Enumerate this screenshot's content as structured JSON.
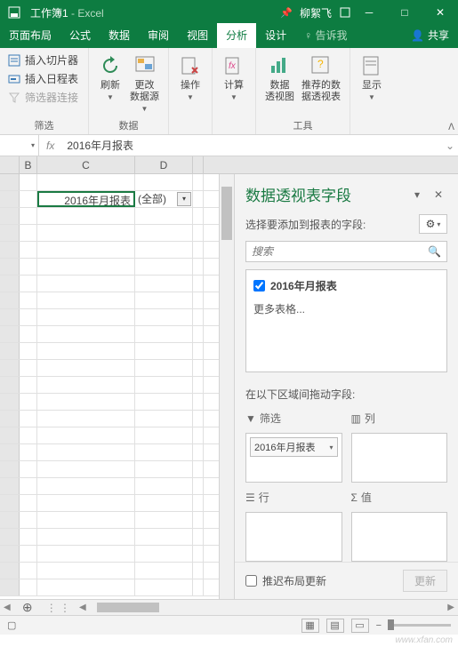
{
  "title": {
    "file": "工作簿1",
    "app": "Excel",
    "user": "柳絮飞"
  },
  "ribbonTabs": [
    "页面布局",
    "公式",
    "数据",
    "审阅",
    "视图",
    "分析",
    "设计"
  ],
  "activeTab": 5,
  "tellMe": "告诉我",
  "share": "共享",
  "ribbon": {
    "group1": {
      "slicer": "插入切片器",
      "timeline": "插入日程表",
      "filterConn": "筛选器连接",
      "label": "筛选"
    },
    "group2": {
      "refresh": "刷新",
      "changeSrc": "更改\n数据源",
      "label": "数据"
    },
    "group3": {
      "actions": "操作"
    },
    "group4": {
      "calc": "计算"
    },
    "group5": {
      "pivotchart": "数据\n透视图",
      "recommend": "推荐的数\n据透视表",
      "label": "工具"
    },
    "group6": {
      "show": "显示"
    }
  },
  "formulaBar": {
    "nameBox": "",
    "value": "2016年月报表"
  },
  "columns": {
    "b": "B",
    "c": "C",
    "d": "D"
  },
  "pivot": {
    "field": "2016年月报表",
    "value": "(全部)"
  },
  "taskPane": {
    "title": "数据透视表字段",
    "subtitle": "选择要添加到报表的字段:",
    "searchPlaceholder": "搜索",
    "field1": "2016年月报表",
    "moreTables": "更多表格...",
    "areasLabel": "在以下区域间拖动字段:",
    "areas": {
      "filter": "筛选",
      "columns": "列",
      "rows": "行",
      "values": "值"
    },
    "filterItem": "2016年月报表",
    "deferLayout": "推迟布局更新",
    "update": "更新"
  },
  "watermark": "www.xfan.com"
}
